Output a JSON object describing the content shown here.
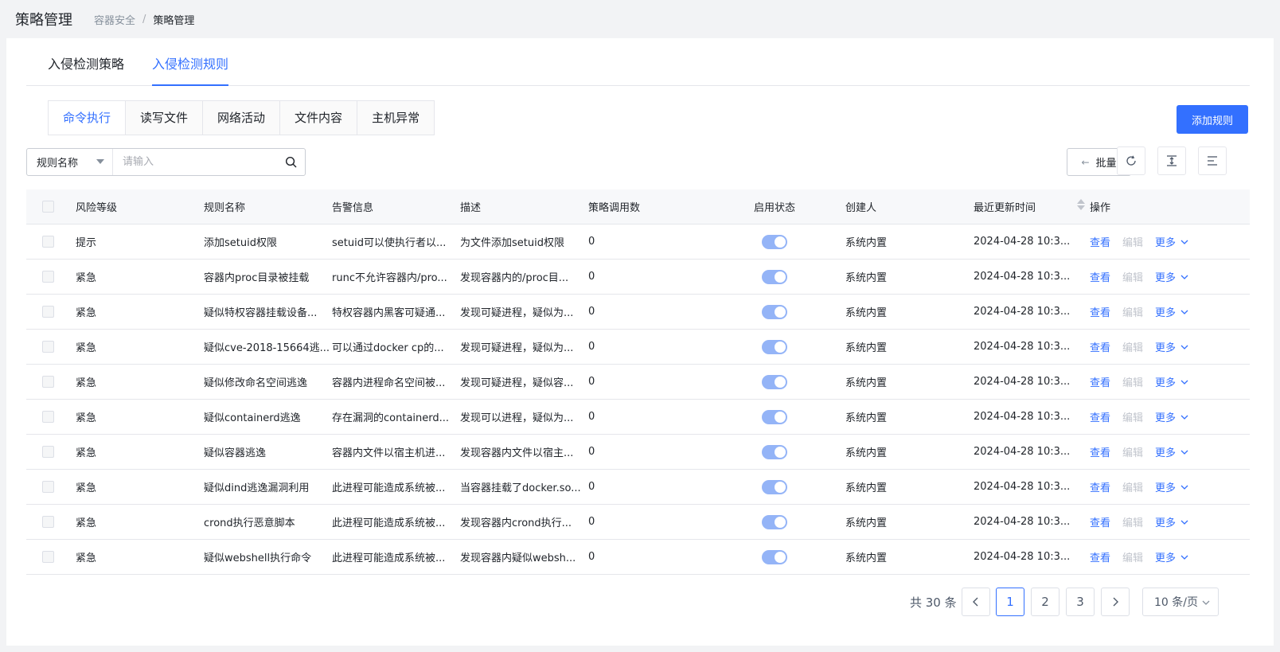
{
  "header": {
    "title": "策略管理",
    "breadcrumb": [
      "容器安全",
      "/",
      "策略管理"
    ]
  },
  "tabs": [
    {
      "label": "入侵检测策略",
      "active": false
    },
    {
      "label": "入侵检测规则",
      "active": true
    }
  ],
  "subtabs": [
    {
      "label": "命令执行",
      "active": true
    },
    {
      "label": "读写文件",
      "active": false
    },
    {
      "label": "网络活动",
      "active": false
    },
    {
      "label": "文件内容",
      "active": false
    },
    {
      "label": "主机异常",
      "active": false
    }
  ],
  "toolbar": {
    "add_label": "添加规则",
    "search_field": "规则名称",
    "search_placeholder": "请输入",
    "batch_label": "批量"
  },
  "table": {
    "columns": [
      "风险等级",
      "规则名称",
      "告警信息",
      "描述",
      "策略调用数",
      "启用状态",
      "创建人",
      "最近更新时间",
      "操作"
    ],
    "rows": [
      {
        "risk": "提示",
        "name": "添加setuid权限",
        "alert": "setuid可以使执行者以...",
        "desc": "为文件添加setuid权限",
        "count": "0",
        "creator": "系统内置",
        "time": "2024-04-28 10:3..."
      },
      {
        "risk": "紧急",
        "name": "容器内proc目录被挂载",
        "alert": "runc不允许容器内/pro...",
        "desc": "发现容器内的/proc目...",
        "count": "0",
        "creator": "系统内置",
        "time": "2024-04-28 10:3..."
      },
      {
        "risk": "紧急",
        "name": "疑似特权容器挂载设备...",
        "alert": "特权容器内黑客可疑通...",
        "desc": "发现可疑进程，疑似为...",
        "count": "0",
        "creator": "系统内置",
        "time": "2024-04-28 10:3..."
      },
      {
        "risk": "紧急",
        "name": "疑似cve-2018-15664逃...",
        "alert": "可以通过docker cp的...",
        "desc": "发现可疑进程，疑似为...",
        "count": "0",
        "creator": "系统内置",
        "time": "2024-04-28 10:3..."
      },
      {
        "risk": "紧急",
        "name": "疑似修改命名空间逃逸",
        "alert": "容器内进程命名空间被...",
        "desc": "发现可疑进程，疑似容...",
        "count": "0",
        "creator": "系统内置",
        "time": "2024-04-28 10:3..."
      },
      {
        "risk": "紧急",
        "name": "疑似containerd逃逸",
        "alert": "存在漏洞的containerd...",
        "desc": "发现可以进程，疑似为...",
        "count": "0",
        "creator": "系统内置",
        "time": "2024-04-28 10:3..."
      },
      {
        "risk": "紧急",
        "name": "疑似容器逃逸",
        "alert": "容器内文件以宿主机进...",
        "desc": "发现容器内文件以宿主...",
        "count": "0",
        "creator": "系统内置",
        "time": "2024-04-28 10:3..."
      },
      {
        "risk": "紧急",
        "name": "疑似dind逃逸漏洞利用",
        "alert": "此进程可能造成系统被...",
        "desc": "当容器挂载了docker.so...",
        "count": "0",
        "creator": "系统内置",
        "time": "2024-04-28 10:3..."
      },
      {
        "risk": "紧急",
        "name": "crond执行恶意脚本",
        "alert": "此进程可能造成系统被...",
        "desc": "发现容器内crond执行...",
        "count": "0",
        "creator": "系统内置",
        "time": "2024-04-28 10:3..."
      },
      {
        "risk": "紧急",
        "name": "疑似webshell执行命令",
        "alert": "此进程可能造成系统被...",
        "desc": "发现容器内疑似websh...",
        "count": "0",
        "creator": "系统内置",
        "time": "2024-04-28 10:3..."
      }
    ],
    "ops": {
      "view": "查看",
      "edit": "编辑",
      "more": "更多"
    }
  },
  "pagination": {
    "total": "共 30 条",
    "pages": [
      "1",
      "2",
      "3"
    ],
    "current": "1",
    "page_size": "10 条/页"
  },
  "colors": {
    "accent": "#3370ff",
    "toggle_on": "#94b4f7",
    "disabled": "#c0c4cc"
  }
}
